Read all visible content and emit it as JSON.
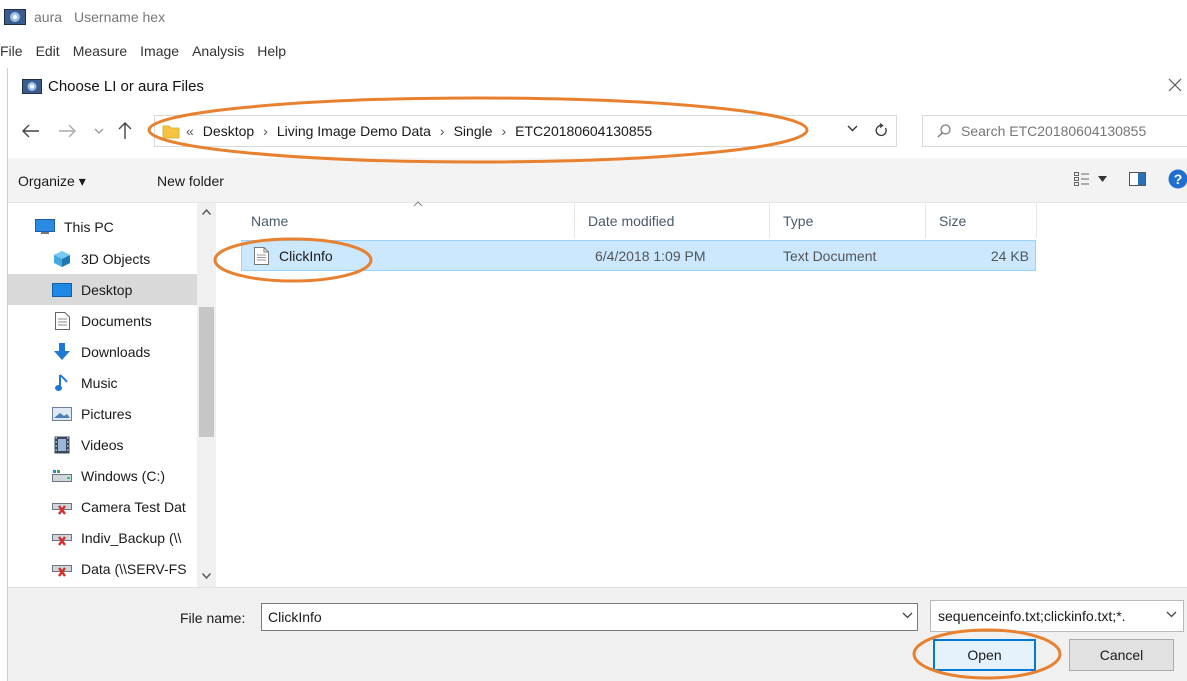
{
  "app": {
    "name": "aura",
    "subtitle": "Username hex"
  },
  "menubar": {
    "items": [
      "File",
      "Edit",
      "Measure",
      "Image",
      "Analysis",
      "Help"
    ]
  },
  "dialog": {
    "title": "Choose LI or aura Files",
    "breadcrumb": {
      "overflow": "«",
      "crumbs": [
        "Desktop",
        "Living Image Demo Data",
        "Single",
        "ETC20180604130855"
      ]
    },
    "search_placeholder": "Search ETC20180604130855",
    "toolbar": {
      "organize": "Organize ▾",
      "new_folder": "New folder"
    },
    "sidebar": {
      "items": [
        {
          "label": "This PC",
          "icon": "computer-icon"
        },
        {
          "label": "3D Objects",
          "icon": "3d-objects-icon"
        },
        {
          "label": "Desktop",
          "icon": "desktop-icon",
          "selected": true
        },
        {
          "label": "Documents",
          "icon": "documents-icon"
        },
        {
          "label": "Downloads",
          "icon": "downloads-icon"
        },
        {
          "label": "Music",
          "icon": "music-icon"
        },
        {
          "label": "Pictures",
          "icon": "pictures-icon"
        },
        {
          "label": "Videos",
          "icon": "videos-icon"
        },
        {
          "label": "Windows (C:)",
          "icon": "drive-icon"
        },
        {
          "label": "Camera Test Dat",
          "icon": "network-drive-disconnected-icon"
        },
        {
          "label": "Indiv_Backup (\\\\",
          "icon": "network-drive-disconnected-icon"
        },
        {
          "label": "Data (\\\\SERV-FS",
          "icon": "network-drive-disconnected-icon"
        }
      ]
    },
    "columns": {
      "name": "Name",
      "date": "Date modified",
      "type": "Type",
      "size": "Size"
    },
    "files": [
      {
        "name": "ClickInfo",
        "date": "6/4/2018 1:09 PM",
        "type": "Text Document",
        "size": "24 KB",
        "selected": true
      }
    ],
    "file_name_label": "File name:",
    "file_name_value": "ClickInfo",
    "filter_value": "sequenceinfo.txt;clickinfo.txt;*.",
    "buttons": {
      "open": "Open",
      "cancel": "Cancel"
    }
  },
  "colors": {
    "highlight_oval": "#e8812f",
    "selection_bg": "#cce8ff",
    "selection_border": "#99d1ff",
    "focus_border": "#0078d7"
  }
}
